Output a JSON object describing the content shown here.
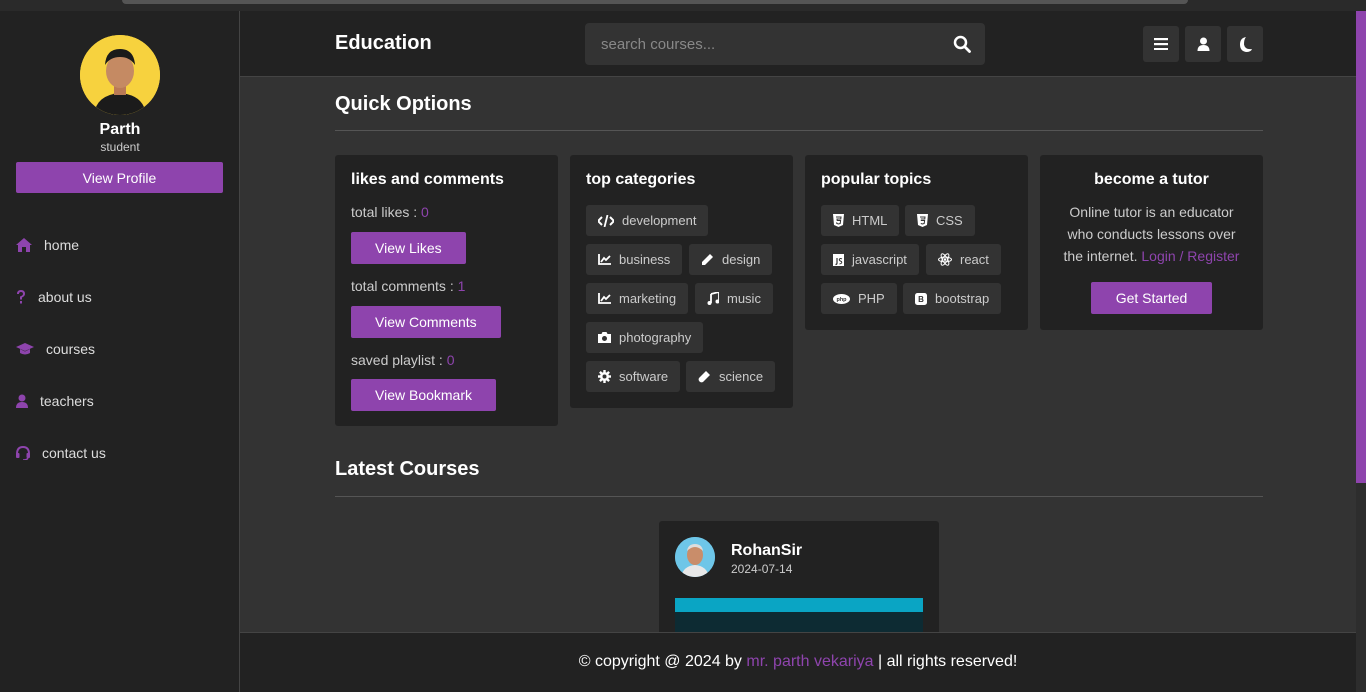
{
  "sidebar": {
    "name": "Parth",
    "role": "student",
    "view_profile": "View Profile",
    "items": [
      {
        "label": "home",
        "icon": "home-icon"
      },
      {
        "label": "about us",
        "icon": "question-icon"
      },
      {
        "label": "courses",
        "icon": "graduation-cap-icon"
      },
      {
        "label": "teachers",
        "icon": "user-icon"
      },
      {
        "label": "contact us",
        "icon": "headset-icon"
      }
    ]
  },
  "header": {
    "brand": "Education",
    "search_placeholder": "search courses..."
  },
  "quick": {
    "title": "Quick Options",
    "likes": {
      "title": "likes and comments",
      "total_likes_label": "total likes : ",
      "total_likes": "0",
      "view_likes": "View Likes",
      "total_comments_label": "total comments : ",
      "total_comments": "1",
      "view_comments": "View Comments",
      "saved_playlist_label": "saved playlist : ",
      "saved_playlist": "0",
      "view_bookmark": "View Bookmark"
    },
    "categories": {
      "title": "top categories",
      "items": [
        "development",
        "business",
        "design",
        "marketing",
        "music",
        "photography",
        "software",
        "science"
      ]
    },
    "topics": {
      "title": "popular topics",
      "items": [
        "HTML",
        "CSS",
        "javascript",
        "react",
        "PHP",
        "bootstrap"
      ]
    },
    "tutor": {
      "title": "become a tutor",
      "text": "Online tutor is an educator who conducts lessons over the internet.",
      "link": "Login / Register",
      "button": "Get Started"
    }
  },
  "latest": {
    "title": "Latest Courses",
    "card": {
      "tutor": "RohanSir",
      "date": "2024-07-14"
    }
  },
  "footer": {
    "prefix": "© copyright @ 2024 by ",
    "author": "mr. parth vekariya",
    "suffix": " | all rights reserved!"
  },
  "colors": {
    "accent": "#8e44ad",
    "background": "#333333",
    "panel": "#222222"
  }
}
